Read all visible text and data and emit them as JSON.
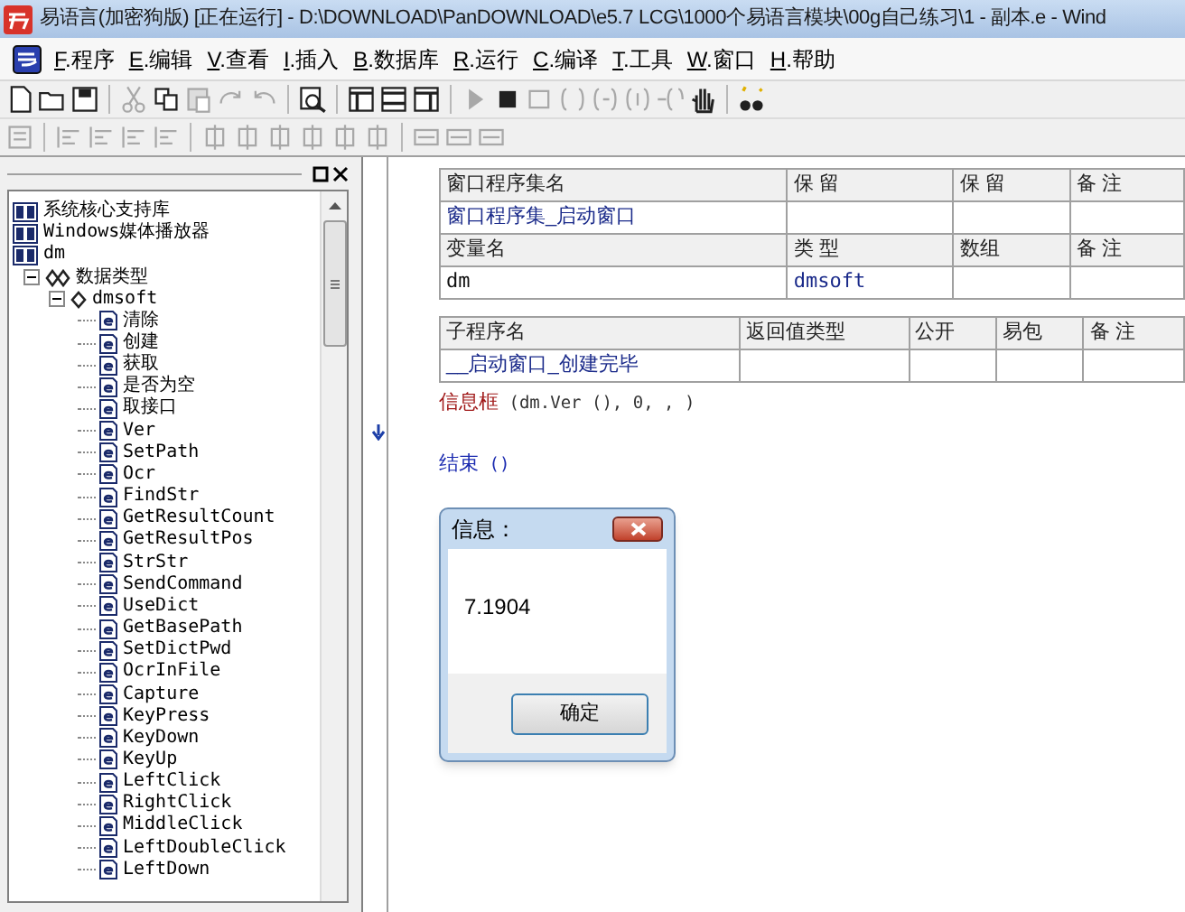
{
  "window": {
    "title": "易语言(加密狗版) [正在运行] - D:\\DOWNLOAD\\PanDOWNLOAD\\e5.7 LCG\\1000个易语言模块\\00g自己练习\\1 - 副本.e - Wind"
  },
  "menu": [
    "F.程序",
    "E.编辑",
    "V.查看",
    "I.插入",
    "B.数据库",
    "R.运行",
    "C.编译",
    "T.工具",
    "W.窗口",
    "H.帮助"
  ],
  "tree": [
    {
      "label": "系统核心支持库",
      "kind": "library"
    },
    {
      "label": "Windows媒体播放器",
      "kind": "library"
    },
    {
      "label": "dm",
      "kind": "library",
      "children": [
        {
          "label": "数据类型",
          "kind": "types",
          "expanded": true,
          "children": [
            {
              "label": "dmsoft",
              "kind": "class",
              "expanded": true,
              "children": [
                {
                  "label": "清除",
                  "kind": "method"
                },
                {
                  "label": "创建",
                  "kind": "method"
                },
                {
                  "label": "获取",
                  "kind": "method"
                },
                {
                  "label": "是否为空",
                  "kind": "method"
                },
                {
                  "label": "取接口",
                  "kind": "method"
                },
                {
                  "label": "Ver",
                  "kind": "method"
                },
                {
                  "label": "SetPath",
                  "kind": "method"
                },
                {
                  "label": "Ocr",
                  "kind": "method"
                },
                {
                  "label": "FindStr",
                  "kind": "method"
                },
                {
                  "label": "GetResultCount",
                  "kind": "method"
                },
                {
                  "label": "GetResultPos",
                  "kind": "method"
                },
                {
                  "label": "StrStr",
                  "kind": "method"
                },
                {
                  "label": "SendCommand",
                  "kind": "method"
                },
                {
                  "label": "UseDict",
                  "kind": "method"
                },
                {
                  "label": "GetBasePath",
                  "kind": "method"
                },
                {
                  "label": "SetDictPwd",
                  "kind": "method"
                },
                {
                  "label": "OcrInFile",
                  "kind": "method"
                },
                {
                  "label": "Capture",
                  "kind": "method"
                },
                {
                  "label": "KeyPress",
                  "kind": "method"
                },
                {
                  "label": "KeyDown",
                  "kind": "method"
                },
                {
                  "label": "KeyUp",
                  "kind": "method"
                },
                {
                  "label": "LeftClick",
                  "kind": "method"
                },
                {
                  "label": "RightClick",
                  "kind": "method"
                },
                {
                  "label": "MiddleClick",
                  "kind": "method"
                },
                {
                  "label": "LeftDoubleClick",
                  "kind": "method"
                },
                {
                  "label": "LeftDown",
                  "kind": "method"
                }
              ]
            }
          ]
        }
      ]
    }
  ],
  "tables": [
    {
      "rows": [
        {
          "kind": "header",
          "cells": [
            "窗口程序集名",
            "保 留",
            "保 留",
            "备 注"
          ]
        },
        {
          "kind": "name",
          "cells": [
            "窗口程序集_启动窗口",
            "",
            "",
            ""
          ]
        },
        {
          "kind": "header",
          "cells": [
            "变量名",
            "类 型",
            "数组",
            "备 注"
          ]
        },
        {
          "kind": "mono",
          "cells": [
            "dm",
            "dmsoft",
            "",
            ""
          ]
        }
      ]
    },
    {
      "rows": [
        {
          "kind": "header",
          "cells": [
            "子程序名",
            "返回值类型",
            "公开",
            "易包",
            "备 注"
          ]
        },
        {
          "kind": "name",
          "cells": [
            "__启动窗口_创建完毕",
            "",
            "",
            "",
            ""
          ]
        }
      ]
    }
  ],
  "code": [
    {
      "kind": "call",
      "command": "信息框",
      "args": " (dm.Ver (), 0, , )"
    },
    {
      "kind": "keyword",
      "command": "结束",
      "args": " ()"
    }
  ],
  "dialog": {
    "title": "信息：",
    "message": "7.1904",
    "button": "确定"
  }
}
